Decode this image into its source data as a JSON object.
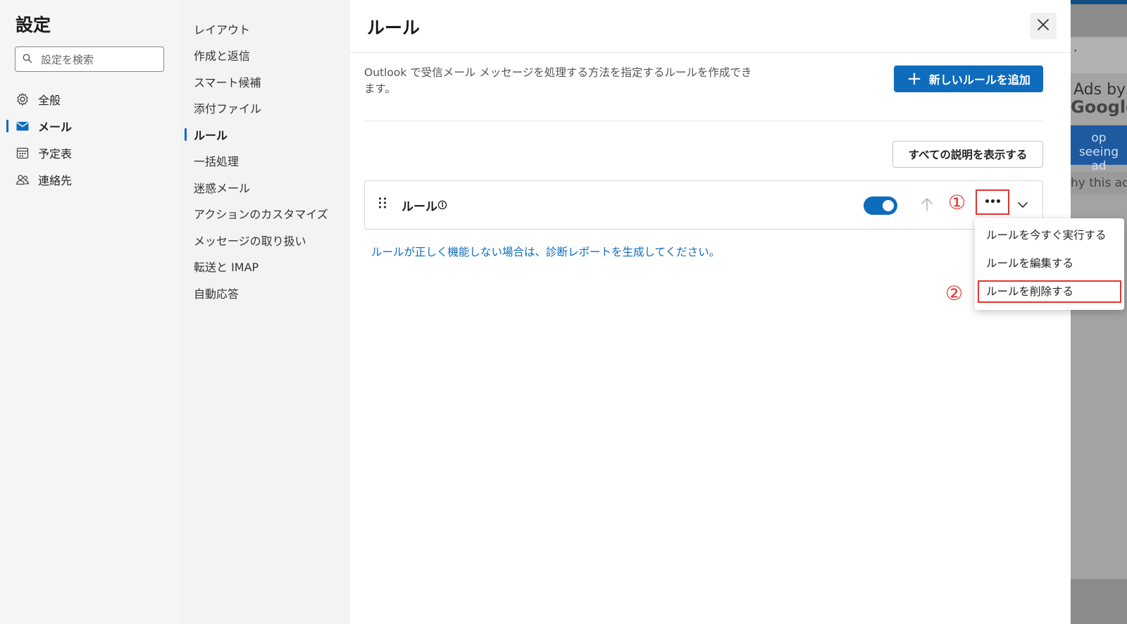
{
  "background": {
    "ad_dot": "·",
    "ads_by": "Ads by",
    "google": "Google",
    "stop_seeing": "op seeing ad",
    "why_this_ad": "hy this ad?"
  },
  "settings": {
    "title": "設定",
    "search_placeholder": "設定を検索",
    "nav": [
      {
        "label": "全般",
        "icon": "gear-icon"
      },
      {
        "label": "メール",
        "icon": "mail-icon"
      },
      {
        "label": "予定表",
        "icon": "calendar-icon"
      },
      {
        "label": "連絡先",
        "icon": "people-icon"
      }
    ],
    "active_nav": "メール"
  },
  "mail_nav": {
    "items": [
      "レイアウト",
      "作成と返信",
      "スマート候補",
      "添付ファイル",
      "ルール",
      "一括処理",
      "迷惑メール",
      "アクションのカスタマイズ",
      "メッセージの取り扱い",
      "転送と IMAP",
      "自動応答"
    ],
    "active": "ルール"
  },
  "rules": {
    "title": "ルール",
    "description": "Outlook で受信メール メッセージを処理する方法を指定するルールを作成できます。",
    "add_button": "新しいルールを追加",
    "add_icon": "+",
    "show_all_button": "すべての説明を表示する",
    "rule": {
      "name": "ルール",
      "enabled": true,
      "more_label": "•••"
    },
    "diagnostic_link": "ルールが正しく機能しない場合は、診断レポートを生成してください。"
  },
  "menu": {
    "items": [
      "ルールを今すぐ実行する",
      "ルールを編集する",
      "ルールを削除する"
    ]
  },
  "annotations": {
    "marker1": "①",
    "marker2": "②",
    "highlight_color": "#e3342f"
  },
  "colors": {
    "accent": "#0f6cbd"
  }
}
